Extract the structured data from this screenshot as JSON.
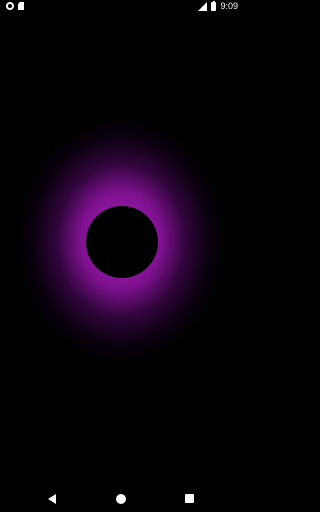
{
  "status_bar": {
    "time": "9:09",
    "icons": {
      "left": [
        "notification-circle-icon",
        "sd-card-icon"
      ],
      "right": [
        "signal-icon",
        "battery-icon"
      ]
    }
  },
  "main": {
    "glow_color": "#b428c8",
    "center_color": "#000000"
  },
  "nav_bar": {
    "icons": [
      "back-icon",
      "home-icon",
      "recents-icon"
    ]
  }
}
